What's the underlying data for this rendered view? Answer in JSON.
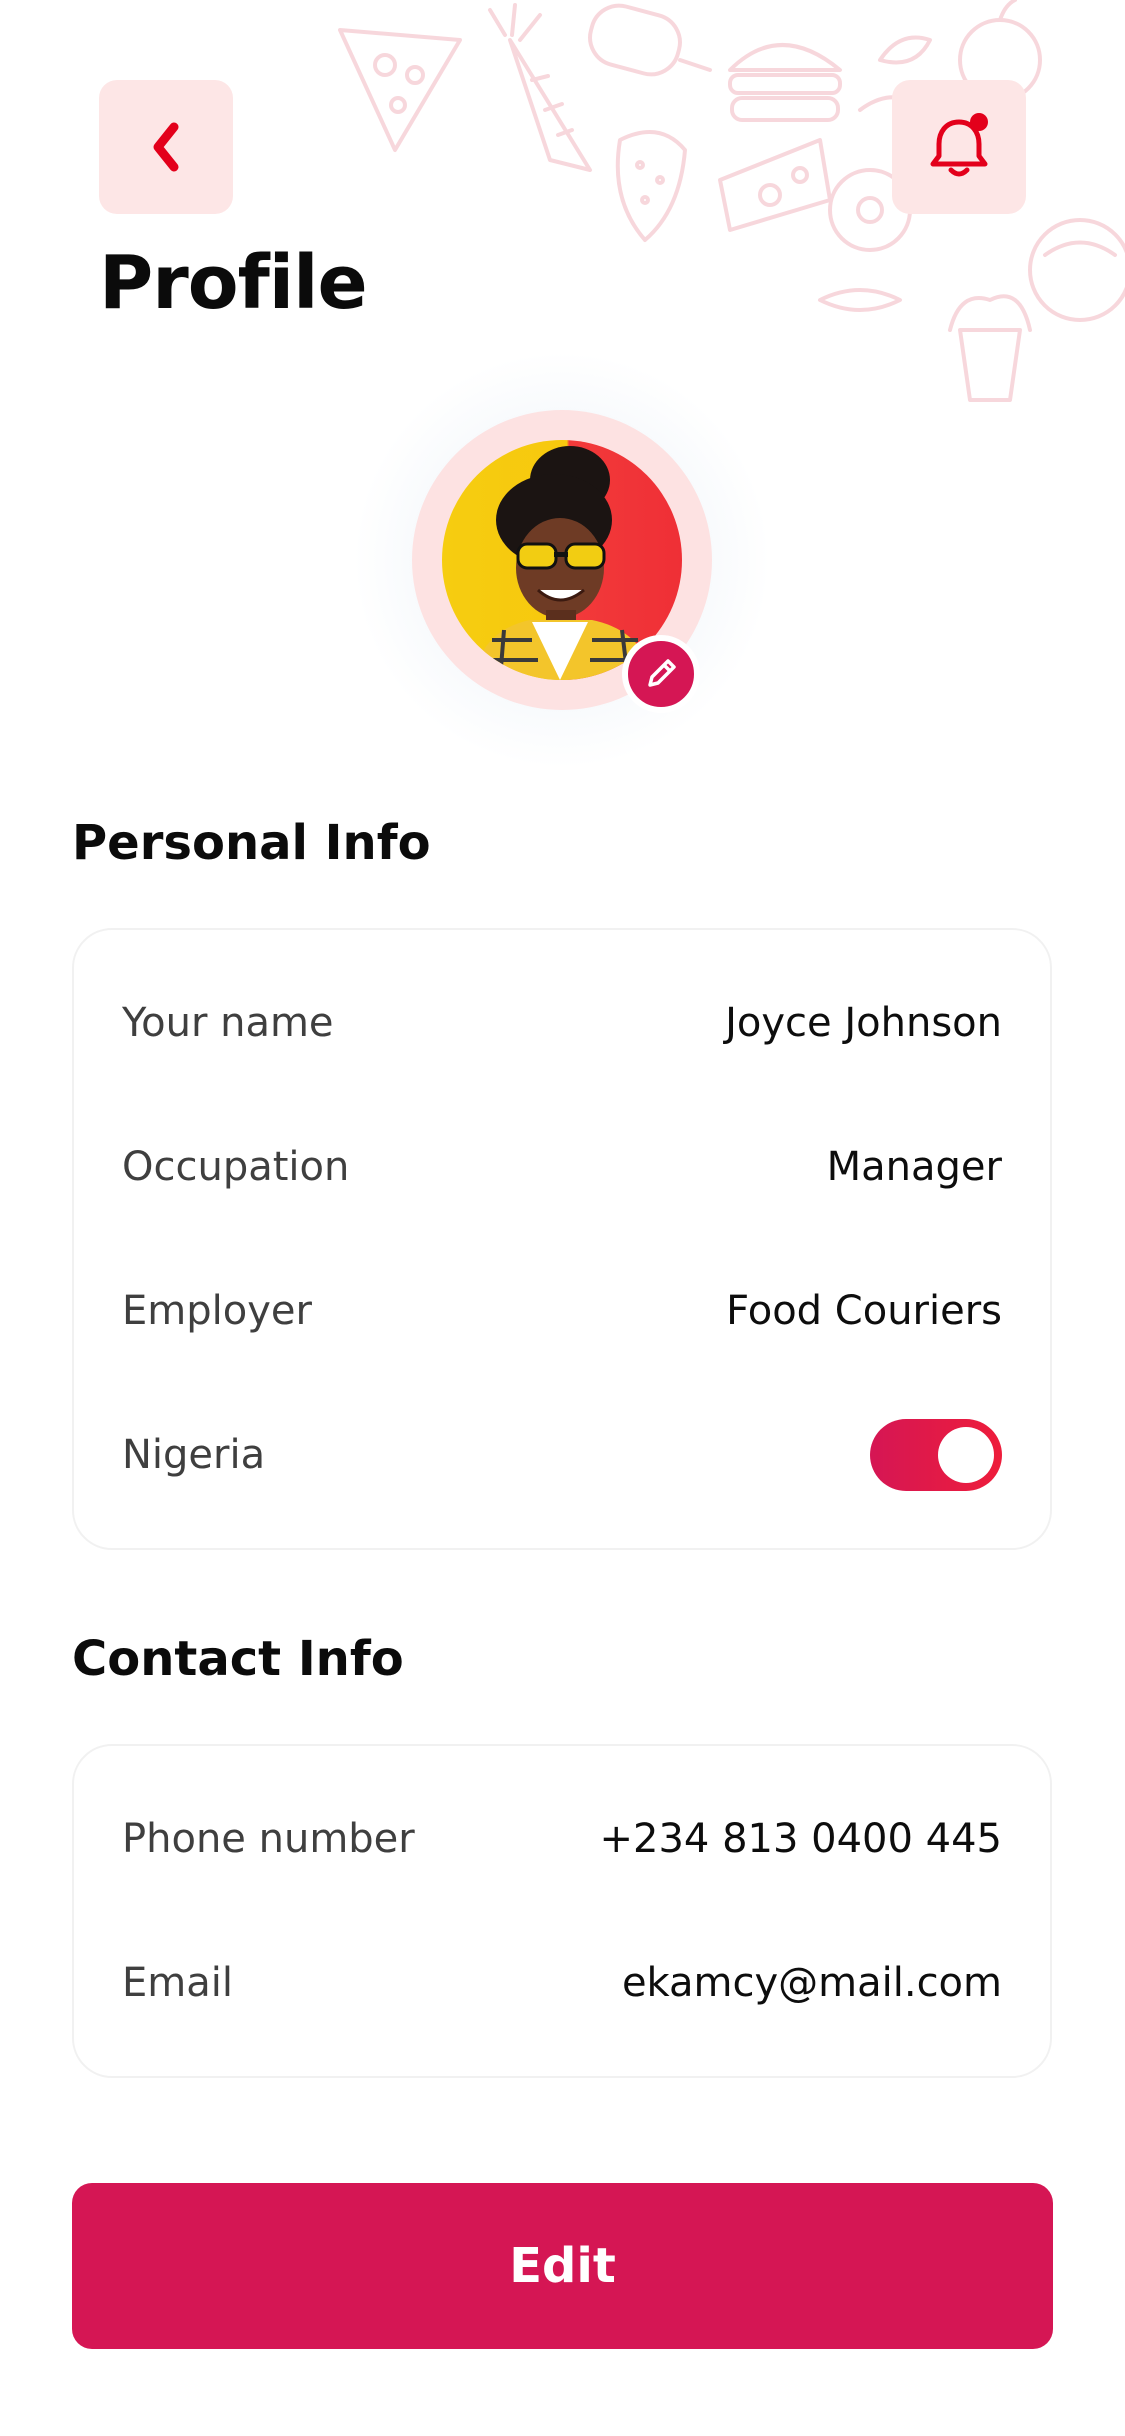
{
  "header": {
    "title": "Profile",
    "back_icon": "chevron-left-icon",
    "notification_icon": "bell-icon"
  },
  "profile": {
    "avatar": "user-avatar",
    "edit_icon": "pencil-icon"
  },
  "personal_info": {
    "title": "Personal Info",
    "rows": [
      {
        "label": "Your name",
        "value": "Joyce Johnson"
      },
      {
        "label": "Occupation",
        "value": "Manager"
      },
      {
        "label": "Employer",
        "value": "Food Couriers"
      }
    ],
    "toggle_label": "Nigeria",
    "toggle_on": true
  },
  "contact_info": {
    "title": "Contact Info",
    "rows": [
      {
        "label": "Phone number",
        "value": "+234 813 0400 445"
      },
      {
        "label": "Email",
        "value": "ekamcy@mail.com"
      }
    ]
  },
  "actions": {
    "edit_label": "Edit"
  },
  "colors": {
    "accent": "#d51654",
    "accent_alt": "#ee1d3b",
    "soft_red": "#fde6e6"
  }
}
